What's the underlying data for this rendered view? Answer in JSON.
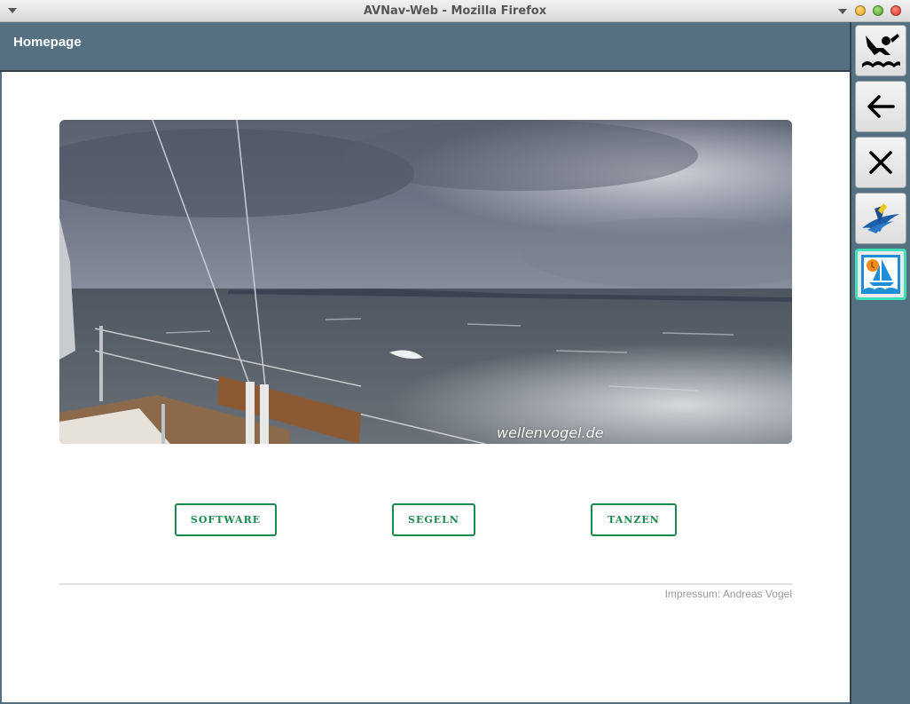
{
  "window": {
    "title": "AVNav-Web - Mozilla Firefox"
  },
  "header": {
    "title": "Homepage"
  },
  "hero": {
    "caption": "wellenvogel.de"
  },
  "nav_buttons": [
    {
      "label": "SOFTWARE"
    },
    {
      "label": "SEGELN"
    },
    {
      "label": "TANZEN"
    }
  ],
  "footer": {
    "text": "Impressum: Andreas Vogel"
  },
  "side_buttons": [
    {
      "icon": "man-overboard-icon"
    },
    {
      "icon": "back-arrow-icon"
    },
    {
      "icon": "close-icon"
    },
    {
      "icon": "avnav-logo-icon"
    },
    {
      "icon": "wellenvogel-sailboat-icon",
      "active": true
    }
  ],
  "colors": {
    "panel": "#557080",
    "button_accent": "#1c8a4c",
    "active_border": "#3ee0b8"
  }
}
